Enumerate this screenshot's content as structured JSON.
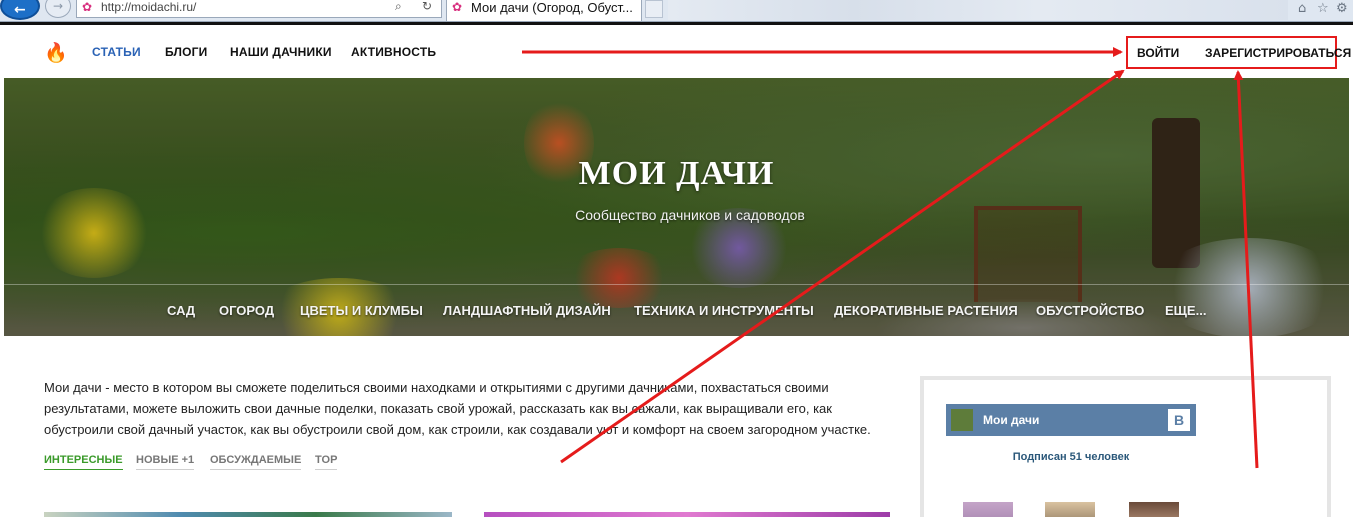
{
  "browser": {
    "url": "http://moidachi.ru/",
    "tab_title": "Мои дачи (Огород, Обуст...",
    "back_glyph": "←",
    "forward_glyph": "→",
    "favicon_glyph": "✿",
    "search_glyph": "⌕",
    "refresh_glyph": "↻",
    "home_glyph": "⌂",
    "star_glyph": "☆",
    "gear_glyph": "⚙"
  },
  "header": {
    "logo_glyph": "🔥",
    "nav": [
      "СТАТЬИ",
      "БЛОГИ",
      "НАШИ ДАЧНИКИ",
      "АКТИВНОСТЬ"
    ],
    "login_label": "ВОЙТИ",
    "register_label": "ЗАРЕГИСТРИРОВАТЬСЯ"
  },
  "hero": {
    "title": "МОИ ДАЧИ",
    "subtitle": "Сообщество дачников и садоводов",
    "categories": [
      "САД",
      "ОГОРОД",
      "ЦВЕТЫ И КЛУМБЫ",
      "ЛАНДШАФТНЫЙ ДИЗАЙН",
      "ТЕХНИКА И ИНСТРУМЕНТЫ",
      "ДЕКОРАТИВНЫЕ РАСТЕНИЯ",
      "ОБУСТРОЙСТВО",
      "ЕЩЕ..."
    ]
  },
  "main": {
    "intro": "Мои дачи - место в котором вы сможете поделиться своими находками и открытиями с другими дачниками, похвастаться своими результатами, можете выложить свои дачные поделки, показать свой урожай, рассказать как вы сажали, как выращивали его, как обустроили свой дачный участок, как вы обустроили свой дом, как строили, как создавали уют и комфорт на своем загородном участке.",
    "filters": [
      "ИНТЕРЕСНЫЕ",
      "НОВЫЕ +1",
      "ОБСУЖДАЕМЫЕ",
      "TOP"
    ]
  },
  "widget": {
    "group_name": "Мои дачи",
    "vk_logo": "B",
    "subscribers": "Подписан 51 человек"
  },
  "colors": {
    "accent_blue": "#2a62b5",
    "annotation_red": "#e51b1b",
    "filter_active_green": "#3a9a2a",
    "vk_blue": "#5b7fa6"
  }
}
